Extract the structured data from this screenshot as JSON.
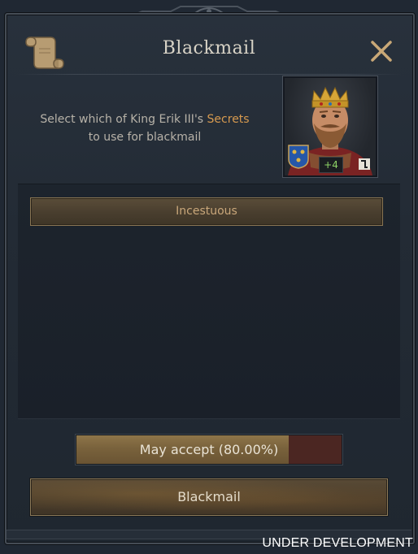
{
  "window": {
    "title": "Blackmail"
  },
  "description": {
    "line1_prefix": "Select which of King Erik III's ",
    "line1_highlight": "Secrets",
    "line2": "to use for blackmail"
  },
  "character": {
    "opinion": "+4",
    "coat_of_arms_icon": "coat-of-arms-three-crowns-icon",
    "rank_icon": "tier-badge-icon"
  },
  "secrets": [
    {
      "label": "Incestuous"
    }
  ],
  "acceptance": {
    "label": "May accept (80.00%)",
    "value_percent": 80
  },
  "actions": {
    "confirm_label": "Blackmail"
  },
  "banner": {
    "text": "UNDER DEVELOPMENT"
  },
  "colors": {
    "highlight": "#d79a4f",
    "accept_fill": "#8e7549",
    "accept_remaining": "#4b2622",
    "close_icon": "#c9a877",
    "opinion_positive": "#8fd467"
  }
}
